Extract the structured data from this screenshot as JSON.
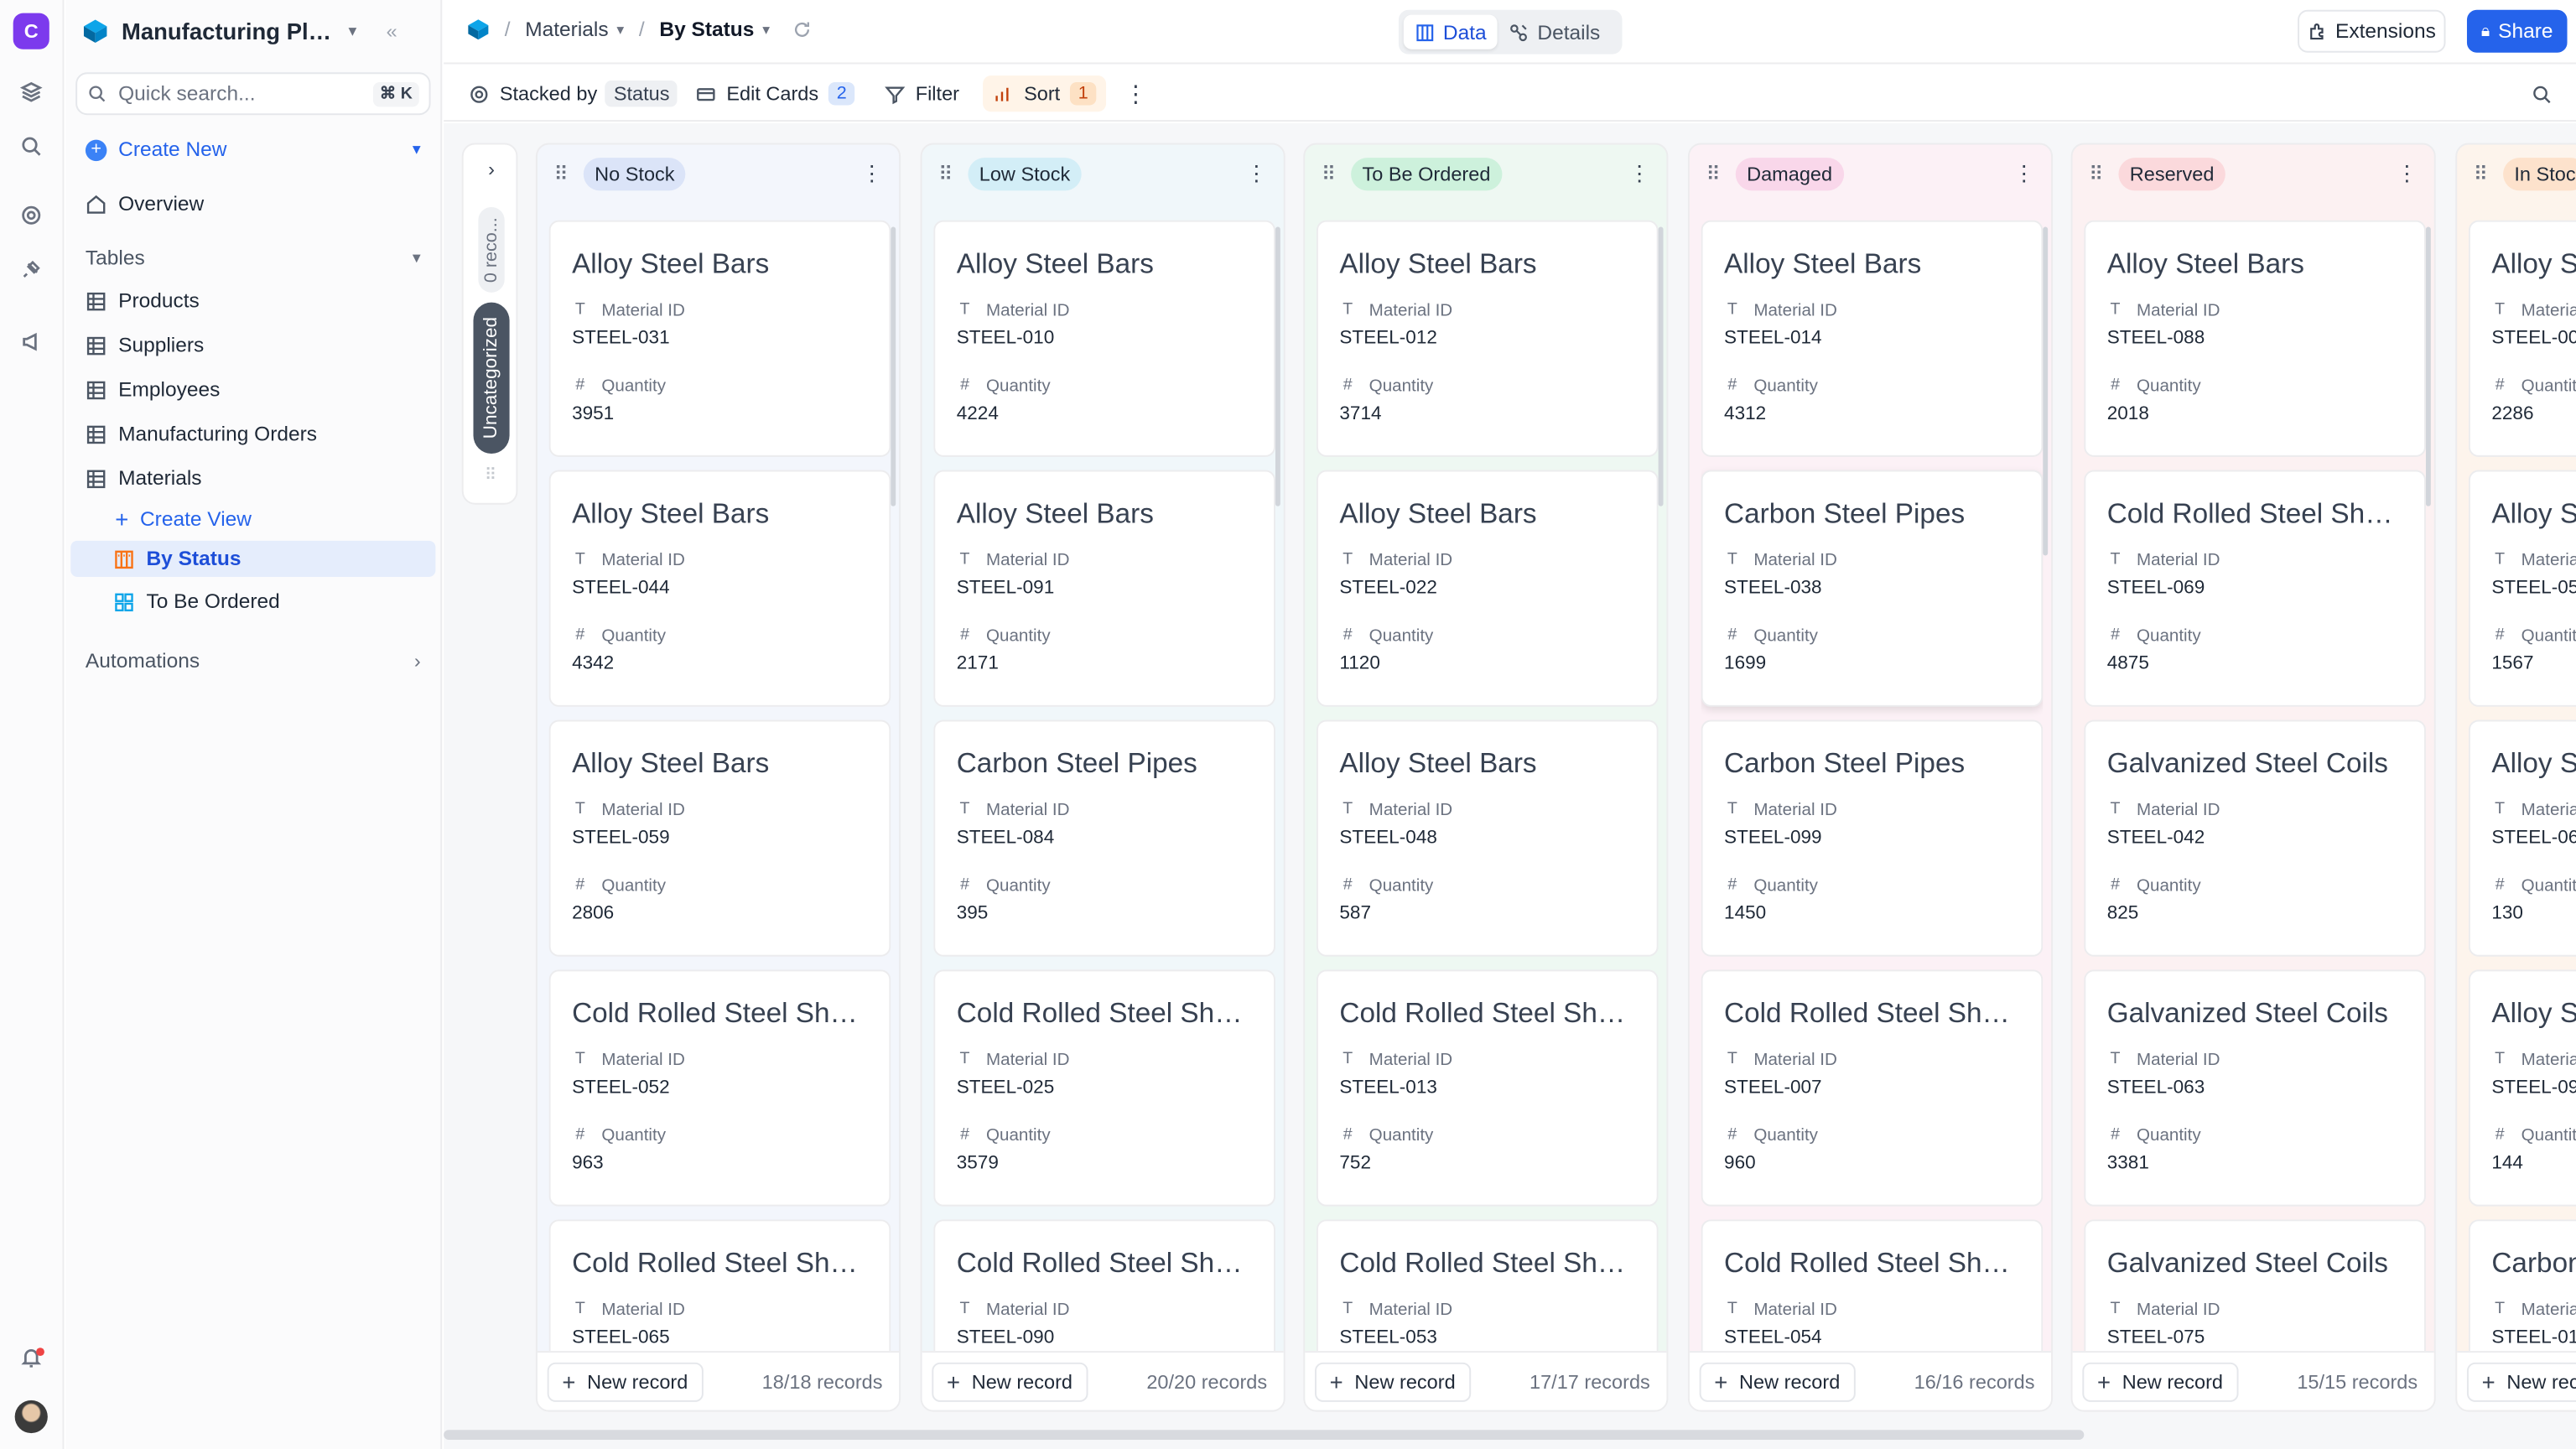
{
  "workspace": {
    "initial": "C"
  },
  "sidebar": {
    "title": "Manufacturing Pla...",
    "search_placeholder": "Quick search...",
    "search_shortcut": "⌘ K",
    "create_new": "Create New",
    "overview": "Overview",
    "tables_label": "Tables",
    "tables": [
      "Products",
      "Suppliers",
      "Employees",
      "Manufacturing Orders",
      "Materials"
    ],
    "create_view": "Create View",
    "views": [
      "By Status",
      "To Be Ordered"
    ],
    "automations": "Automations"
  },
  "topbar": {
    "crumb_table": "Materials",
    "crumb_view": "By Status",
    "tab_data": "Data",
    "tab_details": "Details",
    "extensions": "Extensions",
    "share": "Share"
  },
  "toolbar": {
    "stacked_by": "Stacked by",
    "stacked_field": "Status",
    "edit_cards": "Edit Cards",
    "edit_cards_count": "2",
    "filter": "Filter",
    "sort": "Sort",
    "sort_count": "1"
  },
  "uncategorized": {
    "count_label": "0 reco...",
    "label": "Uncategorized"
  },
  "field_labels": {
    "material_id": "Material ID",
    "quantity": "Quantity"
  },
  "new_record": "New record",
  "columns": [
    {
      "name": "No Stock",
      "badge_color": "#dbe4f8",
      "tint": "#f3f6fc",
      "records": "18/18 records",
      "cards": [
        {
          "title": "Alloy Steel Bars",
          "id": "STEEL-031",
          "qty": "3951"
        },
        {
          "title": "Alloy Steel Bars",
          "id": "STEEL-044",
          "qty": "4342"
        },
        {
          "title": "Alloy Steel Bars",
          "id": "STEEL-059",
          "qty": "2806"
        },
        {
          "title": "Cold Rolled Steel She...",
          "id": "STEEL-052",
          "qty": "963"
        },
        {
          "title": "Cold Rolled Steel She...",
          "id": "STEEL-065",
          "qty": ""
        }
      ]
    },
    {
      "name": "Low Stock",
      "badge_color": "#d3eef7",
      "tint": "#f0f7fa",
      "records": "20/20 records",
      "cards": [
        {
          "title": "Alloy Steel Bars",
          "id": "STEEL-010",
          "qty": "4224"
        },
        {
          "title": "Alloy Steel Bars",
          "id": "STEEL-091",
          "qty": "2171"
        },
        {
          "title": "Carbon Steel Pipes",
          "id": "STEEL-084",
          "qty": "395"
        },
        {
          "title": "Cold Rolled Steel She...",
          "id": "STEEL-025",
          "qty": "3579"
        },
        {
          "title": "Cold Rolled Steel She...",
          "id": "STEEL-090",
          "qty": ""
        }
      ]
    },
    {
      "name": "To Be Ordered",
      "badge_color": "#cdf1dc",
      "tint": "#eef8f2",
      "records": "17/17 records",
      "cards": [
        {
          "title": "Alloy Steel Bars",
          "id": "STEEL-012",
          "qty": "3714"
        },
        {
          "title": "Alloy Steel Bars",
          "id": "STEEL-022",
          "qty": "1120"
        },
        {
          "title": "Alloy Steel Bars",
          "id": "STEEL-048",
          "qty": "587"
        },
        {
          "title": "Cold Rolled Steel She...",
          "id": "STEEL-013",
          "qty": "752"
        },
        {
          "title": "Cold Rolled Steel She...",
          "id": "STEEL-053",
          "qty": ""
        }
      ]
    },
    {
      "name": "Damaged",
      "badge_color": "#f9d7ea",
      "tint": "#fcf1f6",
      "records": "16/16 records",
      "cards": [
        {
          "title": "Alloy Steel Bars",
          "id": "STEEL-014",
          "qty": "4312"
        },
        {
          "title": "Carbon Steel Pipes",
          "id": "STEEL-038",
          "qty": "1699"
        },
        {
          "title": "Carbon Steel Pipes",
          "id": "STEEL-099",
          "qty": "1450"
        },
        {
          "title": "Cold Rolled Steel She...",
          "id": "STEEL-007",
          "qty": "960"
        },
        {
          "title": "Cold Rolled Steel She...",
          "id": "STEEL-054",
          "qty": ""
        }
      ]
    },
    {
      "name": "Reserved",
      "badge_color": "#fbd9dc",
      "tint": "#fcf1f2",
      "records": "15/15 records",
      "cards": [
        {
          "title": "Alloy Steel Bars",
          "id": "STEEL-088",
          "qty": "2018"
        },
        {
          "title": "Cold Rolled Steel She...",
          "id": "STEEL-069",
          "qty": "4875"
        },
        {
          "title": "Galvanized Steel Coils",
          "id": "STEEL-042",
          "qty": "825"
        },
        {
          "title": "Galvanized Steel Coils",
          "id": "STEEL-063",
          "qty": "3381"
        },
        {
          "title": "Galvanized Steel Coils",
          "id": "STEEL-075",
          "qty": ""
        }
      ]
    },
    {
      "name": "In Stoc",
      "badge_color": "#fde2cc",
      "tint": "#fdf4ec",
      "records": "",
      "cards": [
        {
          "title": "Alloy S",
          "id": "STEEL-00",
          "qty": "2286"
        },
        {
          "title": "Alloy S",
          "id": "STEEL-05",
          "qty": "1567"
        },
        {
          "title": "Alloy S",
          "id": "STEEL-06",
          "qty": "130"
        },
        {
          "title": "Alloy S",
          "id": "STEEL-09",
          "qty": "144"
        },
        {
          "title": "Carbon",
          "id": "STEEL-01",
          "qty": ""
        }
      ]
    }
  ]
}
